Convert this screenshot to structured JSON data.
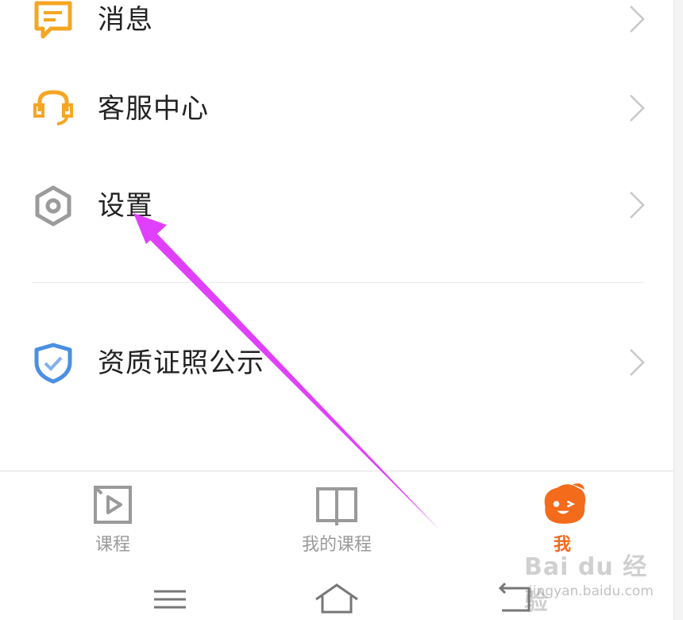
{
  "menu": {
    "items": [
      {
        "label": "消息",
        "icon": "message-icon",
        "color": "#f5a623"
      },
      {
        "label": "客服中心",
        "icon": "headset-icon",
        "color": "#f5a623"
      },
      {
        "label": "设置",
        "icon": "settings-hex-icon",
        "color": "#9b9b9b"
      },
      {
        "label": "资质证照公示",
        "icon": "shield-check-icon",
        "color": "#4a90e2"
      }
    ]
  },
  "tabbar": {
    "tabs": [
      {
        "label": "课程",
        "icon": "play-box-icon",
        "active": false
      },
      {
        "label": "我的课程",
        "icon": "book-icon",
        "active": false
      },
      {
        "label": "我",
        "icon": "avatar-face-icon",
        "active": true
      }
    ],
    "active_color": "#f46b1c",
    "inactive_color": "#9a9a9a"
  },
  "system_nav": {
    "buttons": [
      "menu-icon",
      "home-icon",
      "back-icon"
    ]
  },
  "watermark": {
    "logo": "Bai du 经验",
    "url": "jingyan.baidu.com"
  },
  "annotation": {
    "arrow_color": "#e040fb"
  }
}
